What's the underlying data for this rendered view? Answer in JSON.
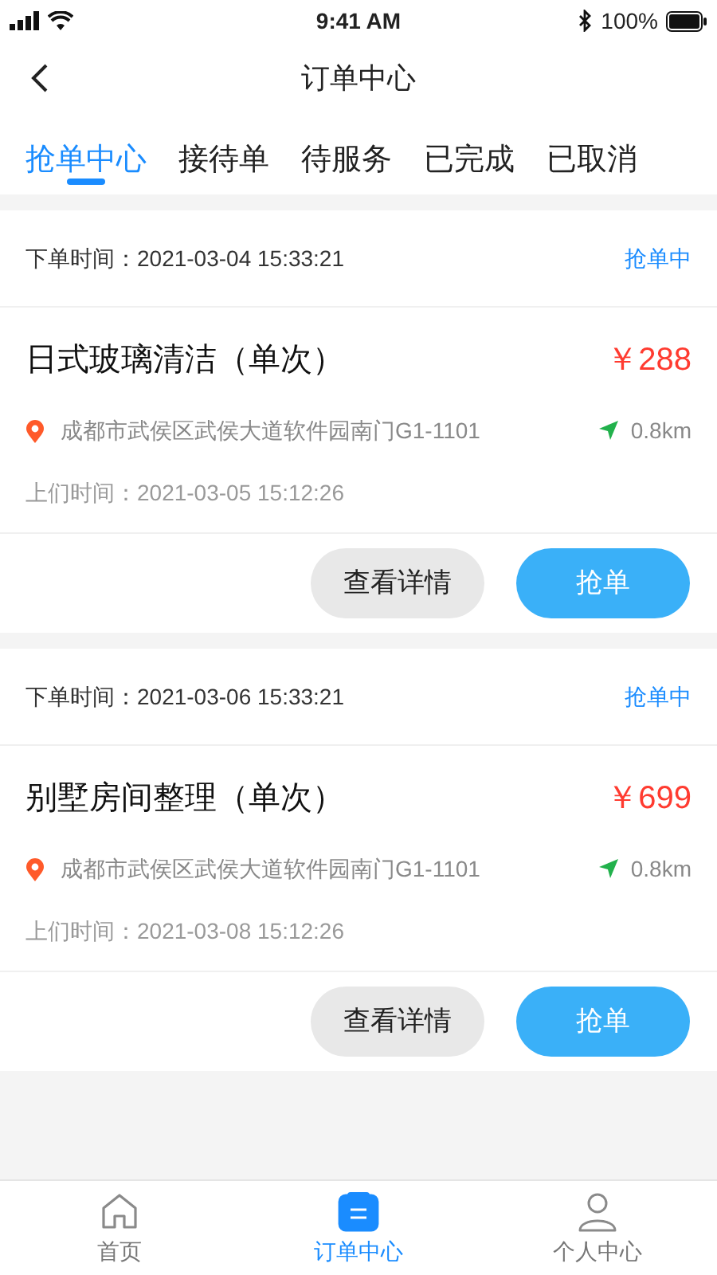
{
  "status_bar": {
    "time": "9:41 AM",
    "battery": "100%"
  },
  "header": {
    "title": "订单中心"
  },
  "tabs": [
    {
      "label": "抢单中心",
      "selected": true
    },
    {
      "label": "接待单",
      "selected": false
    },
    {
      "label": "待服务",
      "selected": false
    },
    {
      "label": "已完成",
      "selected": false
    },
    {
      "label": "已取消",
      "selected": false
    }
  ],
  "orders": [
    {
      "order_time": "下单时间：2021-03-04 15:33:21",
      "status": "抢单中",
      "title": "日式玻璃清洁（单次）",
      "price": "￥288",
      "address": "成都市武侯区武侯大道软件园南门G1-1101",
      "distance": "0.8km",
      "visit_time": "上们时间：2021-03-05 15:12:26",
      "buttons": [
        "查看详情",
        "抢单"
      ]
    },
    {
      "order_time": "下单时间：2021-03-06 15:33:21",
      "status": "抢单中",
      "title": "别墅房间整理（单次）",
      "price": "￥699",
      "address": "成都市武侯区武侯大道软件园南门G1-1101",
      "distance": "0.8km",
      "visit_time": "上们时间：2021-03-08 15:12:26",
      "buttons": [
        "查看详情",
        "抢单"
      ]
    }
  ],
  "bottom_nav": [
    {
      "kind": "home",
      "label": "首页",
      "selected": false
    },
    {
      "kind": "orders",
      "label": "订单中心",
      "selected": true
    },
    {
      "kind": "profile",
      "label": "个人中心",
      "selected": false
    }
  ]
}
